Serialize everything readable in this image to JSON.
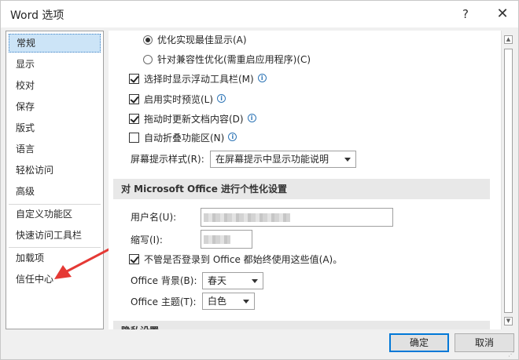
{
  "window": {
    "title": "Word 选项",
    "help": "?",
    "close": "✕"
  },
  "nav": {
    "items": [
      {
        "label": "常规"
      },
      {
        "label": "显示"
      },
      {
        "label": "校对"
      },
      {
        "label": "保存"
      },
      {
        "label": "版式"
      },
      {
        "label": "语言"
      },
      {
        "label": "轻松访问"
      },
      {
        "label": "高级"
      },
      {
        "label": "自定义功能区"
      },
      {
        "label": "快速访问工具栏"
      },
      {
        "label": "加载项"
      },
      {
        "label": "信任中心"
      }
    ],
    "selected": "常规"
  },
  "content": {
    "radio_optimize": "优化实现最佳显示(A)",
    "radio_compat": "针对兼容性优化(需重启应用程序)(C)",
    "chk_minitoolbar": "选择时显示浮动工具栏(M)",
    "chk_livepreview": "启用实时预览(L)",
    "chk_dragupdate": "拖动时更新文档内容(D)",
    "chk_collapse": "自动折叠功能区(N)",
    "screentip_label": "屏幕提示样式(R):",
    "screentip_value": "在屏幕提示中显示功能说明",
    "section_personalize": "对 Microsoft Office 进行个性化设置",
    "username_label": "用户名(U):",
    "initials_label": "缩写(I):",
    "chk_always_use": "不管是否登录到 Office 都始终使用这些值(A)。",
    "background_label": "Office 背景(B):",
    "background_value": "春天",
    "theme_label": "Office 主题(T):",
    "theme_value": "白色",
    "section_privacy": "隐私设置"
  },
  "buttons": {
    "ok": "确定",
    "cancel": "取消"
  },
  "checkbox_states": {
    "minitoolbar": true,
    "livepreview": true,
    "dragupdate": true,
    "collapse": false,
    "always_use": true
  },
  "colors": {
    "selected_bg": "#cce4f7",
    "arrow": "#e53935",
    "accent": "#0078d7"
  }
}
